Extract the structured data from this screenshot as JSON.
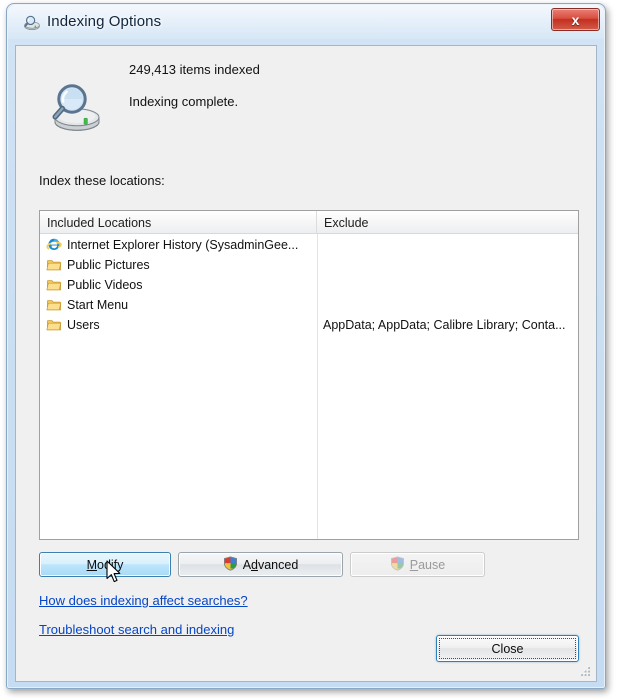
{
  "window": {
    "title": "Indexing Options",
    "title_icon": "indexing-options-icon",
    "close_label": "x"
  },
  "status": {
    "icon": "magnifier-over-drive-icon",
    "items_indexed": "249,413 items indexed",
    "state": "Indexing complete."
  },
  "locations": {
    "label": "Index these locations:",
    "columns": [
      {
        "key": "included",
        "label": "Included Locations"
      },
      {
        "key": "exclude",
        "label": "Exclude"
      }
    ],
    "rows": [
      {
        "icon": "internet-explorer-icon",
        "name": "Internet Explorer History (SysadminGee...",
        "exclude": ""
      },
      {
        "icon": "folder-icon",
        "name": "Public Pictures",
        "exclude": ""
      },
      {
        "icon": "folder-icon",
        "name": "Public Videos",
        "exclude": ""
      },
      {
        "icon": "folder-icon",
        "name": "Start Menu",
        "exclude": ""
      },
      {
        "icon": "folder-icon",
        "name": "Users",
        "exclude": "AppData; AppData; Calibre Library; Conta..."
      }
    ]
  },
  "buttons": {
    "modify": {
      "label": "Modify",
      "accel": "M",
      "state": "hovered"
    },
    "advanced": {
      "label": "Advanced",
      "accel": "d",
      "icon": "uac-shield-icon",
      "state": "normal"
    },
    "pause": {
      "label": "Pause",
      "accel": "P",
      "icon": "uac-shield-icon",
      "state": "disabled"
    },
    "close": {
      "label": "Close",
      "state": "default"
    }
  },
  "links": {
    "how_does_indexing": "How does indexing affect searches?",
    "troubleshoot": "Troubleshoot search and indexing"
  },
  "colors": {
    "accent_link": "#0645c4",
    "dialog_bg": "#f0f0f0",
    "frame_glass": "#cde0f3",
    "close_red": "#c32f20",
    "hover_blue": "#bee6fd"
  }
}
